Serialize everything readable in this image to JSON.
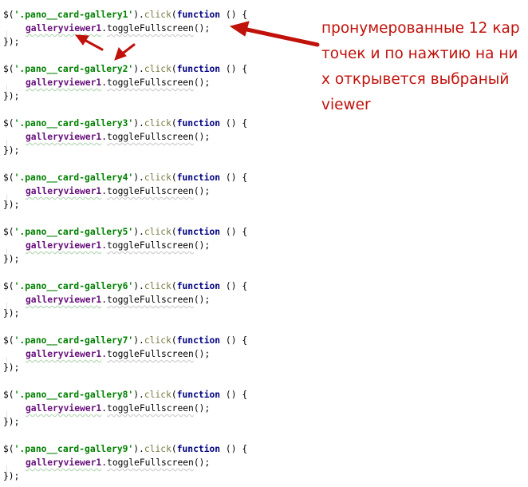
{
  "code": {
    "blocks": [
      {
        "selector": "'.pano__card-gallery1'",
        "viewer": "galleryviewer1"
      },
      {
        "selector": "'.pano__card-gallery2'",
        "viewer": "galleryviewer1"
      },
      {
        "selector": "'.pano__card-gallery3'",
        "viewer": "galleryviewer1"
      },
      {
        "selector": "'.pano__card-gallery4'",
        "viewer": "galleryviewer1"
      },
      {
        "selector": "'.pano__card-gallery5'",
        "viewer": "galleryviewer1"
      },
      {
        "selector": "'.pano__card-gallery6'",
        "viewer": "galleryviewer1"
      },
      {
        "selector": "'.pano__card-gallery7'",
        "viewer": "galleryviewer1"
      },
      {
        "selector": "'.pano__card-gallery8'",
        "viewer": "galleryviewer1"
      },
      {
        "selector": "'.pano__card-gallery9'",
        "viewer": "galleryviewer1"
      }
    ],
    "tokens": {
      "dollar_open": "$(",
      "close_dot": ").",
      "click": "click",
      "paren_open": "(",
      "function_kw": "function",
      "fn_tail": " () {",
      "dot": ".",
      "method_call": "toggleFullscreen",
      "call_end": "();",
      "block_end": "});"
    }
  },
  "annotation": {
    "text": "пронумерованные 12 карточек и по нажтию на них открывется выбраный viewer",
    "color": "#c0110b"
  },
  "arrows": {
    "color": "#c0110b"
  }
}
